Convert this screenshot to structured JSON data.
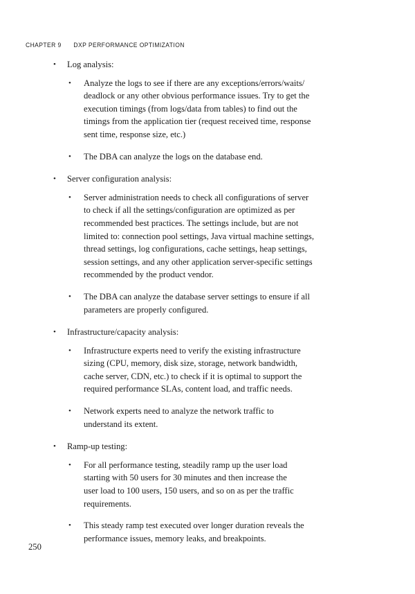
{
  "header": {
    "chapter_label": "CHAPTER 9",
    "title": "DXP PERFORMANCE OPTIMIZATION"
  },
  "folio": {
    "page_number": "250"
  },
  "bullet_glyph": "bullet-point",
  "body": {
    "sections": [
      {
        "heading": "Log analysis:",
        "subitems": [
          "Analyze the logs to see if there are any exceptions/errors/waits/\ndeadlock or any other obvious performance issues. Try to get the\nexecution timings (from logs/data from tables) to find out the\ntimings from the application tier (request received time, response\nsent time, response size, etc.)",
          "The DBA can analyze the logs on the database end."
        ]
      },
      {
        "heading": "Server configuration analysis:",
        "subitems": [
          "Server administration needs to check all configurations of server\nto check if all the settings/configuration are optimized as per\nrecommended best practices. The settings include, but are not\nlimited to: connection pool settings, Java virtual machine settings,\nthread settings, log configurations, cache settings, heap settings,\nsession settings, and any other application server-specific settings\nrecommended by the product vendor.",
          "The DBA can analyze the database server settings to ensure if all\nparameters are properly configured."
        ]
      },
      {
        "heading": "Infrastructure/capacity analysis:",
        "subitems": [
          "Infrastructure experts need to verify the existing infrastructure\nsizing (CPU, memory, disk size, storage, network bandwidth,\ncache server, CDN, etc.) to check if it is optimal to support the\nrequired performance SLAs, content load, and traffic needs.",
          "Network experts need to analyze the network traffic to\nunderstand its extent."
        ]
      },
      {
        "heading": "Ramp-up testing:",
        "subitems": [
          "For all performance testing, steadily ramp up the user load\nstarting with 50 users for 30 minutes and then increase the\nuser load to 100 users, 150 users, and so on as per the traffic\nrequirements.",
          "This steady ramp test executed over longer duration reveals the\nperformance issues, memory leaks, and breakpoints."
        ]
      }
    ]
  }
}
